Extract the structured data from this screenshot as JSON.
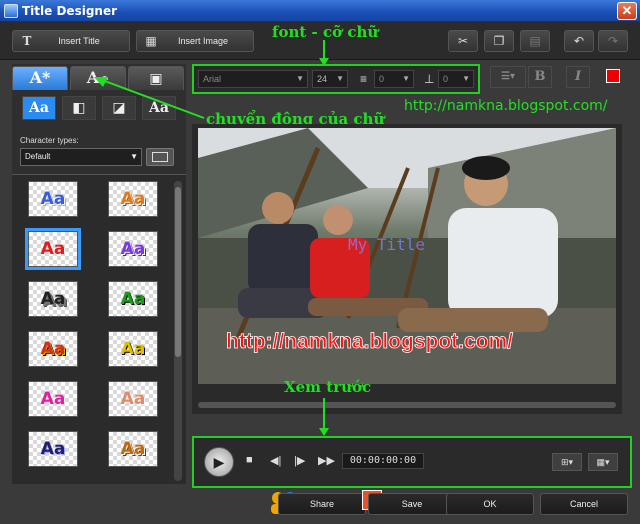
{
  "window": {
    "title": "Title Designer",
    "close_glyph": "✕"
  },
  "toolbar": {
    "insert_title": "Insert Title",
    "insert_image": "Insert Image",
    "icons": [
      "cut-icon",
      "copy-icon",
      "paste-icon",
      "undo-icon",
      "redo-icon"
    ]
  },
  "annotations": {
    "font_size": "font - cỡ chữ",
    "motion": "chuyển động của chữ",
    "url": "http://namkna.blogspot.com/",
    "preview": "Xem trước"
  },
  "left_panel": {
    "tabs": [
      "A*",
      "A",
      "image"
    ],
    "sub_styles": [
      "Aa",
      "",
      "",
      "Aa"
    ],
    "character_types_label": "Character types:",
    "character_types_value": "Default",
    "presets": [
      {
        "text": "Aa",
        "color": "#3b5bd8"
      },
      {
        "text": "Aa",
        "color": "#e07a1a"
      },
      {
        "text": "Aa",
        "color": "#e01c1c"
      },
      {
        "text": "Aa",
        "color": "#7a3be0"
      },
      {
        "text": "Aa",
        "color": "#222222"
      },
      {
        "text": "Aa",
        "color": "#1c9e1c"
      },
      {
        "text": "Aa",
        "color": "#d03020"
      },
      {
        "text": "Aa",
        "color": "#e0c000"
      },
      {
        "text": "Aa",
        "color": "#e020a0"
      },
      {
        "text": "Aa",
        "color": "#e08a6a"
      },
      {
        "text": "Aa",
        "color": "#22206a"
      },
      {
        "text": "Aa",
        "color": "#c06a10"
      }
    ]
  },
  "font_bar": {
    "font": "Arial",
    "size": "24",
    "line_spacing": "0",
    "char_spacing": "0"
  },
  "style_buttons": {
    "bold": "B",
    "italic": "I"
  },
  "preview": {
    "watermark": "My Title",
    "overlay_url": "http://namkna.blogspot.com/"
  },
  "transport": {
    "timecode": "00:00:00:00"
  },
  "bottom": {
    "share": "Share",
    "save": "Save",
    "ok": "OK",
    "cancel": "Cancel"
  },
  "colors": {
    "annotation": "#21e021",
    "accent": "#2a8cf0",
    "overlay_text": "#ff1010"
  }
}
